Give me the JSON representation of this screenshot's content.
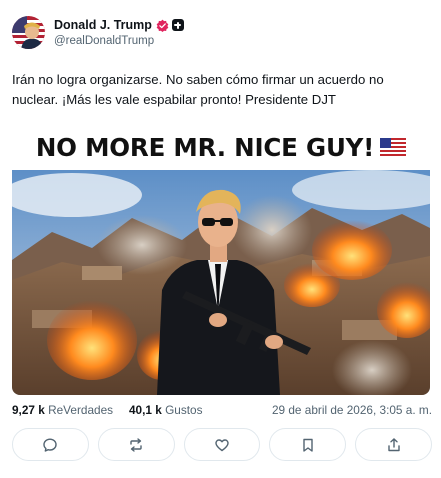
{
  "author": {
    "display_name": "Donald J. Trump",
    "handle": "@realDonaldTrump",
    "avatar_icon": "avatar-flag-portrait",
    "verified_badge_color": "#e0245e"
  },
  "post": {
    "text": "Irán no logra organizarse. No saben cómo firmar un acuerdo no nuclear. ¡Más les vale espabilar pronto! Presidente DJT"
  },
  "media": {
    "banner_text": "NO MORE MR. NICE GUY!",
    "banner_icon": "us-flag-emoji"
  },
  "stats": {
    "reposts_count": "9,27 k",
    "reposts_label": "ReVerdades",
    "likes_count": "40,1 k",
    "likes_label": "Gustos",
    "timestamp": "29 de abril de 2026, 3:05 a. m."
  },
  "actions": [
    {
      "icon": "reply-icon"
    },
    {
      "icon": "retruth-icon"
    },
    {
      "icon": "like-icon"
    },
    {
      "icon": "bookmark-icon"
    },
    {
      "icon": "share-icon"
    }
  ]
}
